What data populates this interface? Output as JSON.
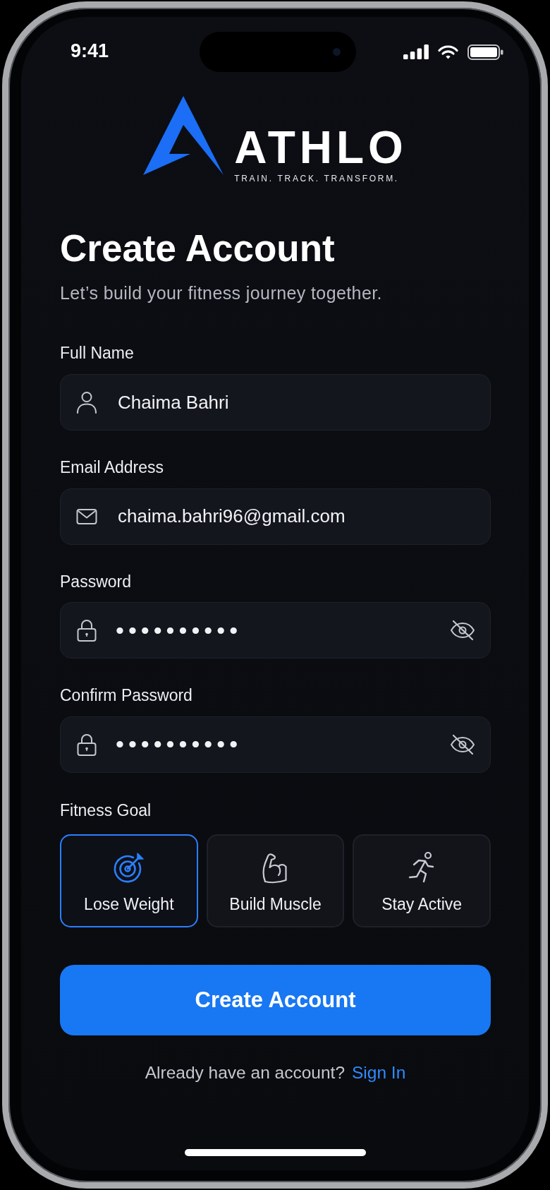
{
  "status_bar": {
    "time": "9:41"
  },
  "logo": {
    "wordmark": "ATHLO",
    "tagline": "TRAIN. TRACK. TRANSFORM."
  },
  "header": {
    "title": "Create Account",
    "subtitle": "Let’s build your fitness journey together."
  },
  "fields": [
    {
      "label": "Full Name",
      "kind": "name",
      "value": "Chaima Bahri"
    },
    {
      "label": "Email Address",
      "kind": "email",
      "value": "chaima.bahri96@gmail.com"
    },
    {
      "label": "Password",
      "kind": "password",
      "value": "••••••••••"
    },
    {
      "label": "Confirm Password",
      "kind": "password",
      "value": "••••••••••"
    }
  ],
  "fitness_goal": {
    "label": "Fitness Goal",
    "options": [
      {
        "label": "Lose Weight",
        "kind": "target",
        "selected": true
      },
      {
        "label": "Build Muscle",
        "kind": "muscle",
        "selected": false
      },
      {
        "label": "Stay Active",
        "kind": "running",
        "selected": false
      }
    ]
  },
  "submit_button": {
    "label": "Create Account"
  },
  "footer": {
    "prompt": "Already have an account?",
    "link": "Sign In"
  }
}
